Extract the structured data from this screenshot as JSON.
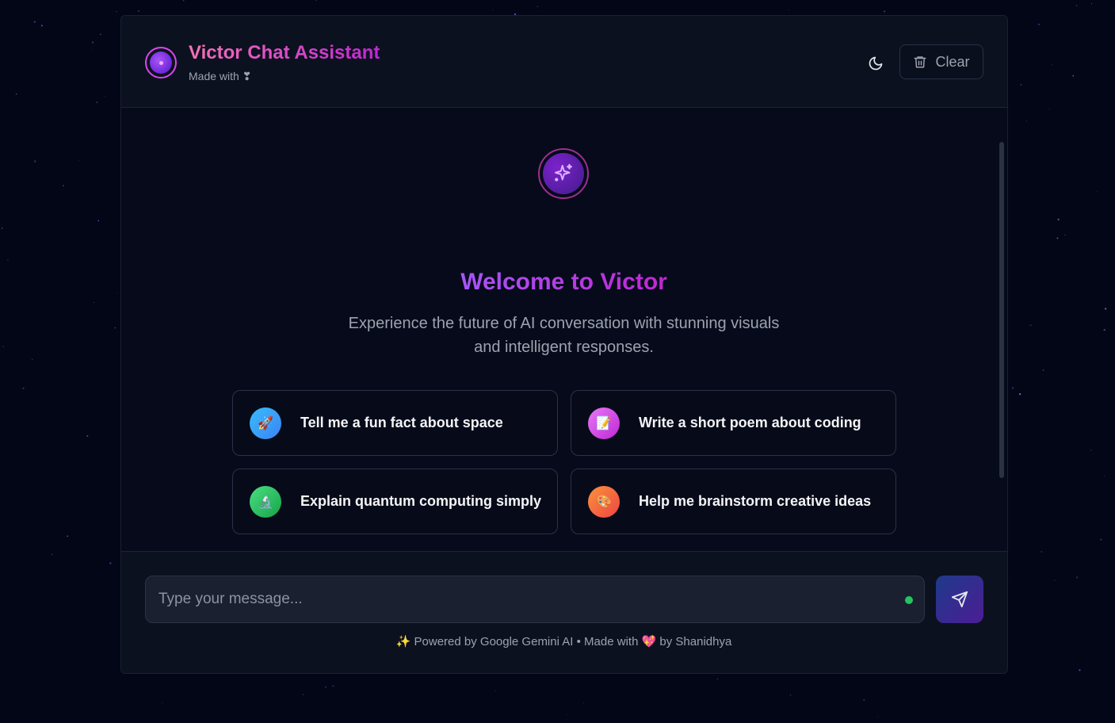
{
  "header": {
    "title": "Victor Chat Assistant",
    "subtitle": "Made with ❣",
    "clear_label": "Clear"
  },
  "welcome": {
    "title": "Welcome to Victor",
    "description": "Experience the future of AI conversation with stunning visuals and intelligent responses."
  },
  "suggestions": [
    {
      "label": "Tell me a fun fact about space",
      "icon": "rocket-icon",
      "emoji": "🚀",
      "color": "#3b82f6"
    },
    {
      "label": "Write a short poem about coding",
      "icon": "memo-icon",
      "emoji": "📝",
      "color": "#c026d3"
    },
    {
      "label": "Explain quantum computing simply",
      "icon": "microscope-icon",
      "emoji": "🔬",
      "color": "#16a34a"
    },
    {
      "label": "Help me brainstorm creative ideas",
      "icon": "palette-icon",
      "emoji": "🎨",
      "color": "#f97316"
    }
  ],
  "composer": {
    "placeholder": "Type your message...",
    "value": ""
  },
  "footer": {
    "credit": "✨ Powered by Google Gemini AI • Made with 💖 by Shanidhya"
  },
  "colors": {
    "accent": "#c026d3",
    "status_online": "#22c55e"
  }
}
